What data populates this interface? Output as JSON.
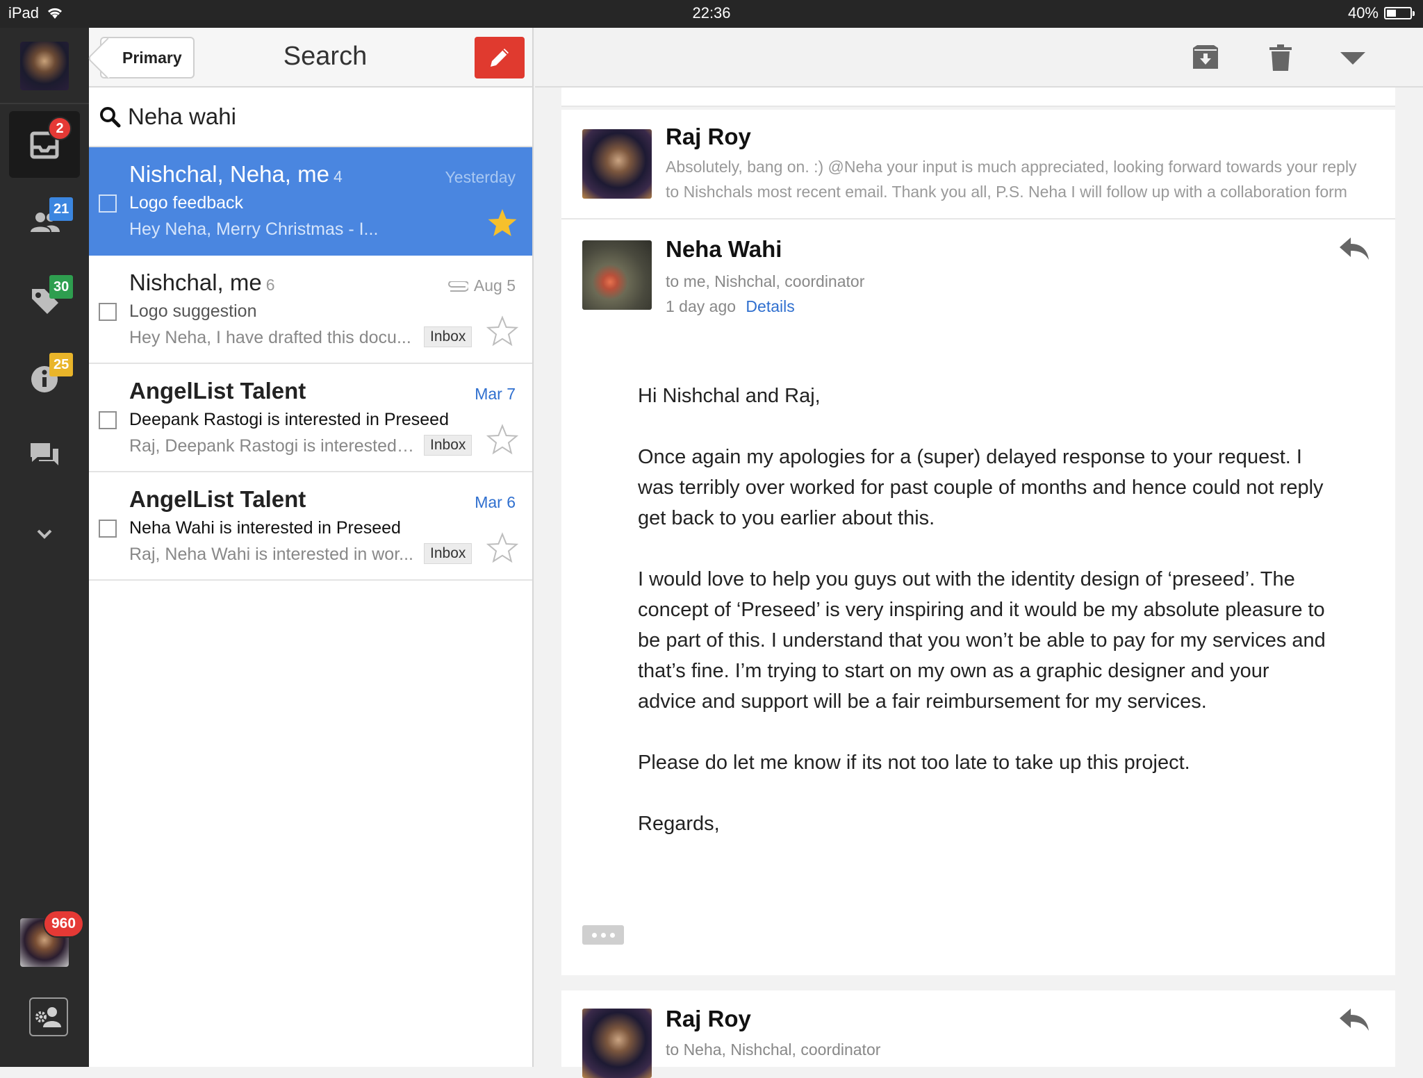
{
  "status_bar": {
    "device": "iPad",
    "time": "22:36",
    "battery": "40%",
    "battery_level": 0.4
  },
  "rail": {
    "badges": {
      "primary": "2",
      "social": "21",
      "promotions": "30",
      "updates": "25",
      "account": "960"
    }
  },
  "list": {
    "back_label": "Primary",
    "title": "Search",
    "search_value": "Neha wahi",
    "threads": [
      {
        "from": "Nishchal, Neha, me",
        "count": "4",
        "date": "Yesterday",
        "subject": "Logo feedback",
        "snippet": "Hey Neha, Merry Christmas - I...",
        "starred": true,
        "selected": true
      },
      {
        "from": "Nishchal, me",
        "count": "6",
        "date": "Aug 5",
        "subject": "Logo suggestion",
        "snippet": "Hey Neha, I have drafted this docu...",
        "label": "Inbox",
        "starred": false,
        "attachment": true
      },
      {
        "from": "AngelList Talent",
        "date": "Mar 7",
        "subject": "Deepank Rastogi is interested in Preseed",
        "snippet": "Raj, Deepank Rastogi is interested i...",
        "label": "Inbox",
        "starred": false,
        "unread": true
      },
      {
        "from": "AngelList Talent",
        "date": "Mar 6",
        "subject": "Neha Wahi is interested in Preseed",
        "snippet": "Raj, Neha Wahi is interested in wor...",
        "label": "Inbox",
        "starred": false,
        "unread": true
      }
    ]
  },
  "messages": {
    "collapsed_1": {
      "sender": "Raj Roy",
      "preview": "Absolutely, bang on. :) @Neha your input is much appreciated, looking forward towards your reply to Nishchals most recent email. Thank you all, P.S. Neha I will follow up with a collaboration form"
    },
    "expanded": {
      "sender": "Neha Wahi",
      "recipients": "to me, Nishchal, coordinator",
      "time": "1 day ago",
      "details_link": "Details",
      "body": [
        "Hi Nishchal and Raj,",
        "Once again my apologies for a (super) delayed response to your request. I was terribly over worked for past couple of months and hence could not reply get back to you earlier about this.",
        "I would love to help you guys out with the identity design of ‘preseed’. The concept of ‘Preseed’ is very inspiring and it would be my absolute pleasure to be part of this. I understand that you won’t be able to pay for my services and that’s fine. I’m trying to start on my own as a graphic designer and your advice and support will be a fair reimbursement for my services.",
        "Please do let me know if its not too late to take up this project.",
        "Regards,"
      ]
    },
    "collapsed_2": {
      "sender": "Raj Roy",
      "recipients": "to Neha, Nishchal, coordinator"
    }
  },
  "colors": {
    "selected_row": "#4a86e0",
    "compose": "#e03a2f",
    "link": "#2f6fcf",
    "star": "#f6c02c"
  }
}
